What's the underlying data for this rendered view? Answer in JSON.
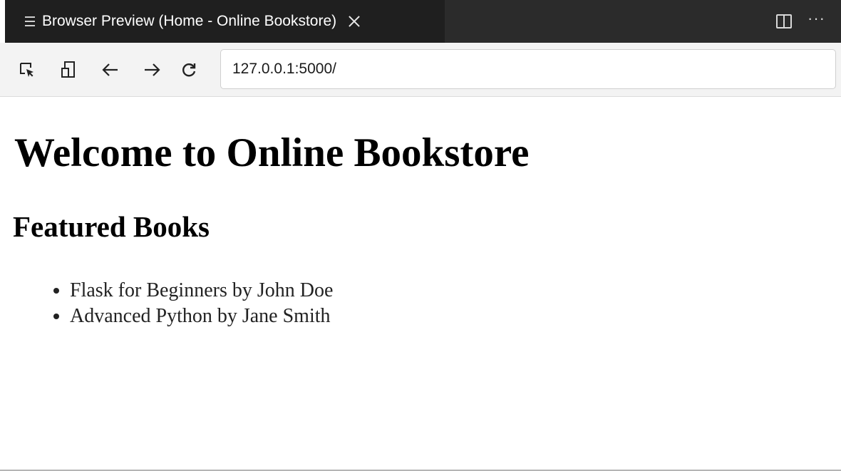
{
  "tab": {
    "title": "Browser Preview (Home - Online Bookstore)",
    "icon": "document-lines-icon",
    "close_icon": "close-icon"
  },
  "tab_actions": {
    "split_icon": "split-editor-icon",
    "more_label": "···"
  },
  "toolbar": {
    "buttons": [
      {
        "name": "inspect-icon"
      },
      {
        "name": "device-toggle-icon"
      },
      {
        "name": "back-arrow-icon"
      },
      {
        "name": "forward-arrow-icon"
      },
      {
        "name": "reload-icon"
      }
    ],
    "url": "127.0.0.1:5000/"
  },
  "page": {
    "heading": "Welcome to Online Bookstore",
    "subheading": "Featured Books",
    "books": [
      "Flask for Beginners by John Doe",
      "Advanced Python by Jane Smith"
    ]
  },
  "colors": {
    "tab_bar": "#2b2b2b",
    "active_tab": "#1f1f1f",
    "toolbar": "#f3f3f3",
    "page_background": "#ffffff"
  }
}
